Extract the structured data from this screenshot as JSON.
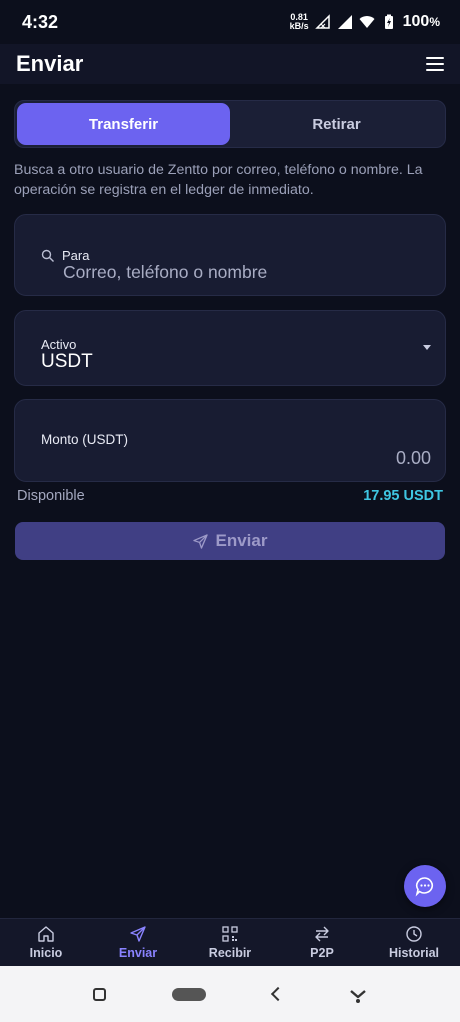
{
  "status_bar": {
    "time": "4:32",
    "net_speed_value": "0.81",
    "net_speed_unit": "kB/s",
    "battery": "100",
    "battery_unit": "%"
  },
  "app_bar": {
    "title": "Enviar",
    "menu_icon": "hamburger-menu-icon"
  },
  "tabs": [
    {
      "label": "Transferir",
      "active": true
    },
    {
      "label": "Retirar",
      "active": false
    }
  ],
  "description": "Busca a otro usuario de Zentto por correo, teléfono o nombre. La operación se registra en el ledger de inmediato.",
  "recipient_field": {
    "label": "Para",
    "placeholder": "Correo, teléfono o nombre",
    "icon": "search-icon"
  },
  "asset_field": {
    "label": "Activo",
    "value": "USDT",
    "icon": "dropdown-arrow-icon"
  },
  "amount_field": {
    "label": "Monto (USDT)",
    "placeholder": "0.00"
  },
  "available": {
    "label": "Disponible",
    "value": "17.95 USDT"
  },
  "send_button": {
    "label": "Enviar",
    "icon": "send-icon"
  },
  "fab": {
    "icon": "chat-icon"
  },
  "bottom_nav": [
    {
      "label": "Inicio",
      "icon": "home-icon",
      "active": false
    },
    {
      "label": "Enviar",
      "icon": "send-icon",
      "active": true
    },
    {
      "label": "Recibir",
      "icon": "qr-code-icon",
      "active": false
    },
    {
      "label": "P2P",
      "icon": "swap-icon",
      "active": false
    },
    {
      "label": "Historial",
      "icon": "history-icon",
      "active": false
    }
  ],
  "colors": {
    "background": "#0c0f1c",
    "accent": "#6c63f0",
    "available_value": "#3fc6e2",
    "active_nav": "#8a83ff"
  }
}
